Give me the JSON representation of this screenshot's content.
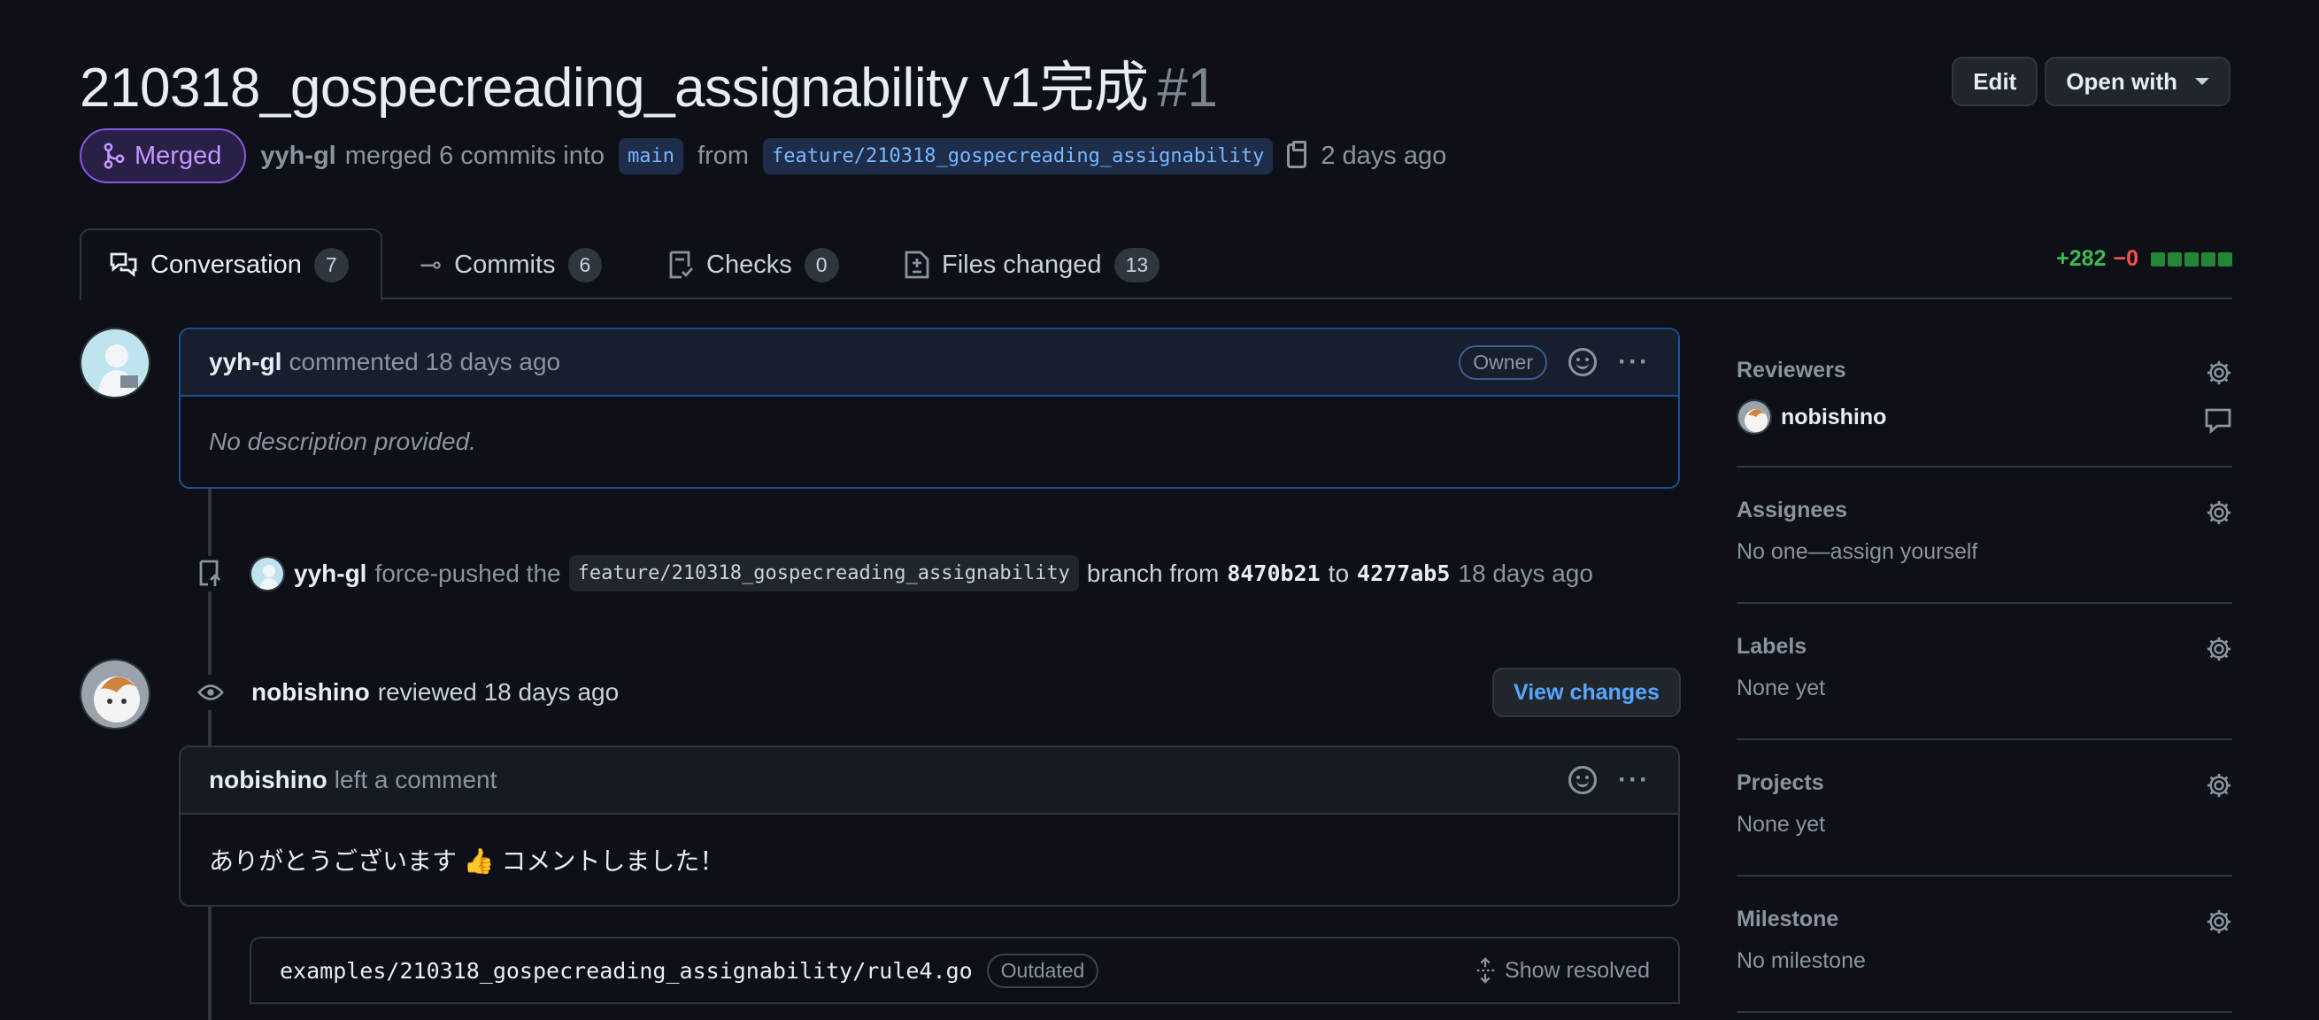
{
  "header": {
    "title": "210318_gospecreading_assignability v1完成",
    "number": "#1",
    "edit_label": "Edit",
    "open_with_label": "Open with"
  },
  "meta": {
    "state": "Merged",
    "author": "yyh-gl",
    "action": "merged 6 commits into",
    "base_branch": "main",
    "from": "from",
    "head_branch": "feature/210318_gospecreading_assignability",
    "time": "2 days ago"
  },
  "tabs": [
    {
      "label": "Conversation",
      "count": "7"
    },
    {
      "label": "Commits",
      "count": "6"
    },
    {
      "label": "Checks",
      "count": "0"
    },
    {
      "label": "Files changed",
      "count": "13"
    }
  ],
  "diffstat": {
    "additions": "+282",
    "deletions": "−0"
  },
  "timeline": {
    "first_comment": {
      "author": "yyh-gl",
      "meta": "commented 18 days ago",
      "badge": "Owner",
      "body": "No description provided."
    },
    "force_push": {
      "author": "yyh-gl",
      "text1": "force-pushed the",
      "branch": "feature/210318_gospecreading_assignability",
      "text2": "branch from",
      "from_sha": "8470b21",
      "to": "to",
      "to_sha": "4277ab5",
      "time": "18 days ago"
    },
    "review": {
      "author": "nobishino",
      "meta": "reviewed 18 days ago",
      "button": "View changes"
    },
    "review_comment": {
      "author": "nobishino",
      "meta": "left a comment",
      "body": "ありがとうございます 👍 コメントしました！"
    },
    "file": {
      "path": "examples/210318_gospecreading_assignability/rule4.go",
      "badge": "Outdated",
      "show_resolved": "Show resolved"
    }
  },
  "sidebar": {
    "reviewers": {
      "title": "Reviewers",
      "name": "nobishino"
    },
    "assignees": {
      "title": "Assignees",
      "value": "No one—assign yourself"
    },
    "labels": {
      "title": "Labels",
      "value": "None yet"
    },
    "projects": {
      "title": "Projects",
      "value": "None yet"
    },
    "milestone": {
      "title": "Milestone",
      "value": "No milestone"
    }
  },
  "colors": {
    "merged": "#8957e5",
    "additions": "#3fb950",
    "deletions": "#f85149",
    "accent": "#58a6ff"
  }
}
